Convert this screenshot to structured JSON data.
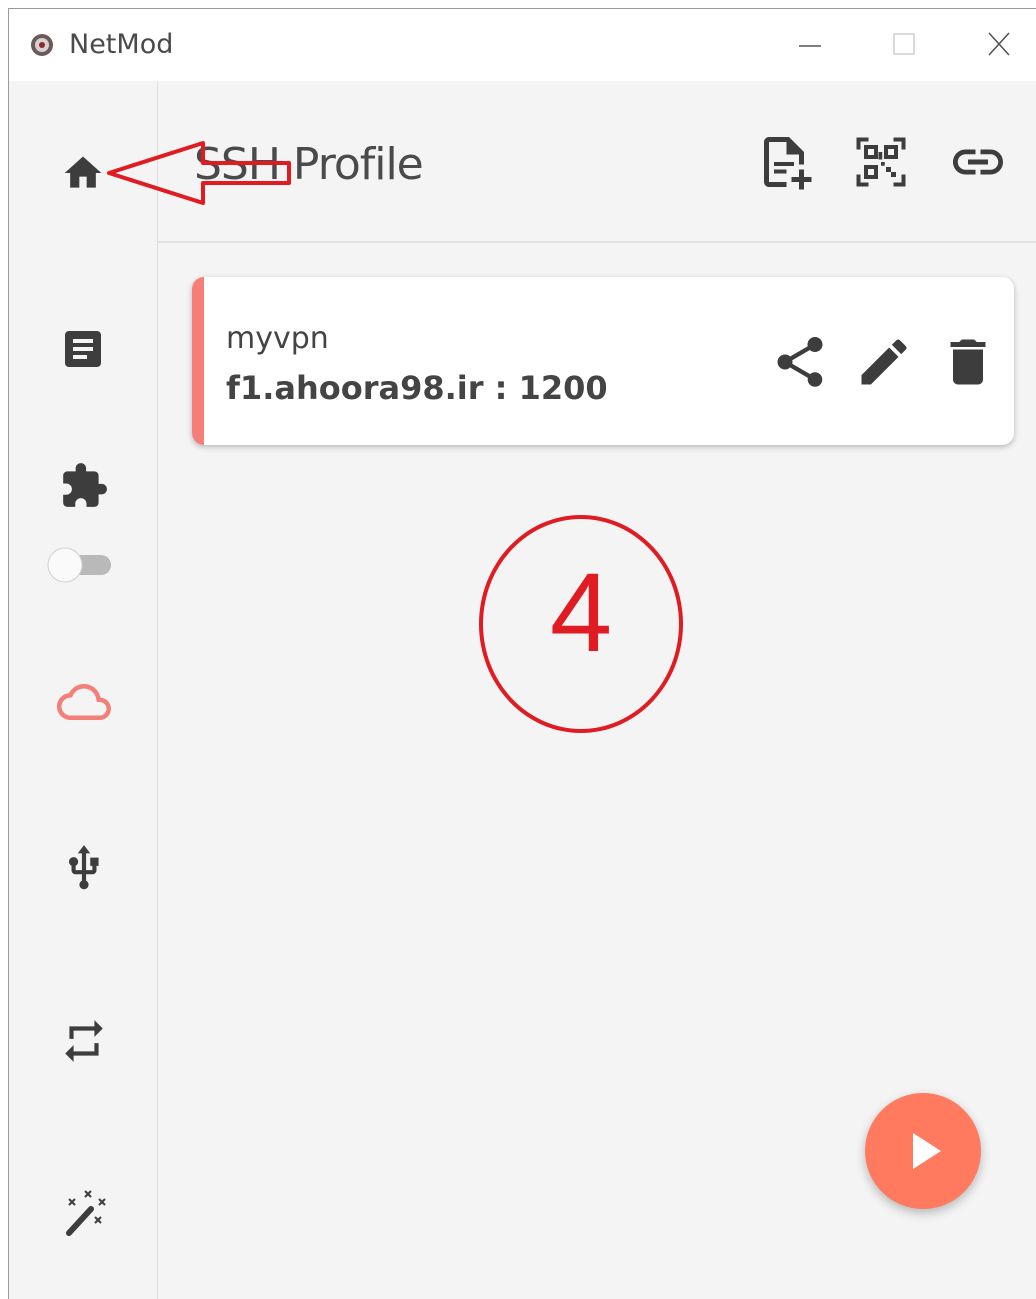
{
  "window": {
    "title": "NetMod",
    "minimize_icon": "minimize-icon",
    "maximize_icon": "maximize-icon",
    "close_icon": "close-icon"
  },
  "sidebar": {
    "items": [
      {
        "id": "home",
        "icon": "home-icon"
      },
      {
        "id": "logs",
        "icon": "document-icon"
      },
      {
        "id": "plugins",
        "icon": "puzzle-icon",
        "toggle_on": false
      },
      {
        "id": "profiles",
        "icon": "cloud-icon",
        "active": true
      },
      {
        "id": "network",
        "icon": "usb-icon"
      },
      {
        "id": "transfer",
        "icon": "swap-icon"
      },
      {
        "id": "tools",
        "icon": "magic-wand-icon"
      }
    ]
  },
  "header": {
    "title": "SSH Profile",
    "actions": [
      "add-file-icon",
      "qr-code-icon",
      "link-icon"
    ]
  },
  "profiles": [
    {
      "name": "myvpn",
      "host": "f1.ahoora98.ir : 1200",
      "actions": [
        "share-icon",
        "edit-icon",
        "delete-icon"
      ]
    }
  ],
  "annotation": {
    "step_number": "4"
  },
  "fab": {
    "icon": "play-icon"
  },
  "colors": {
    "accent": "#f47f77",
    "fab": "#ff7a5e",
    "annotation": "#e01b22",
    "icon": "#3d3d3d"
  }
}
